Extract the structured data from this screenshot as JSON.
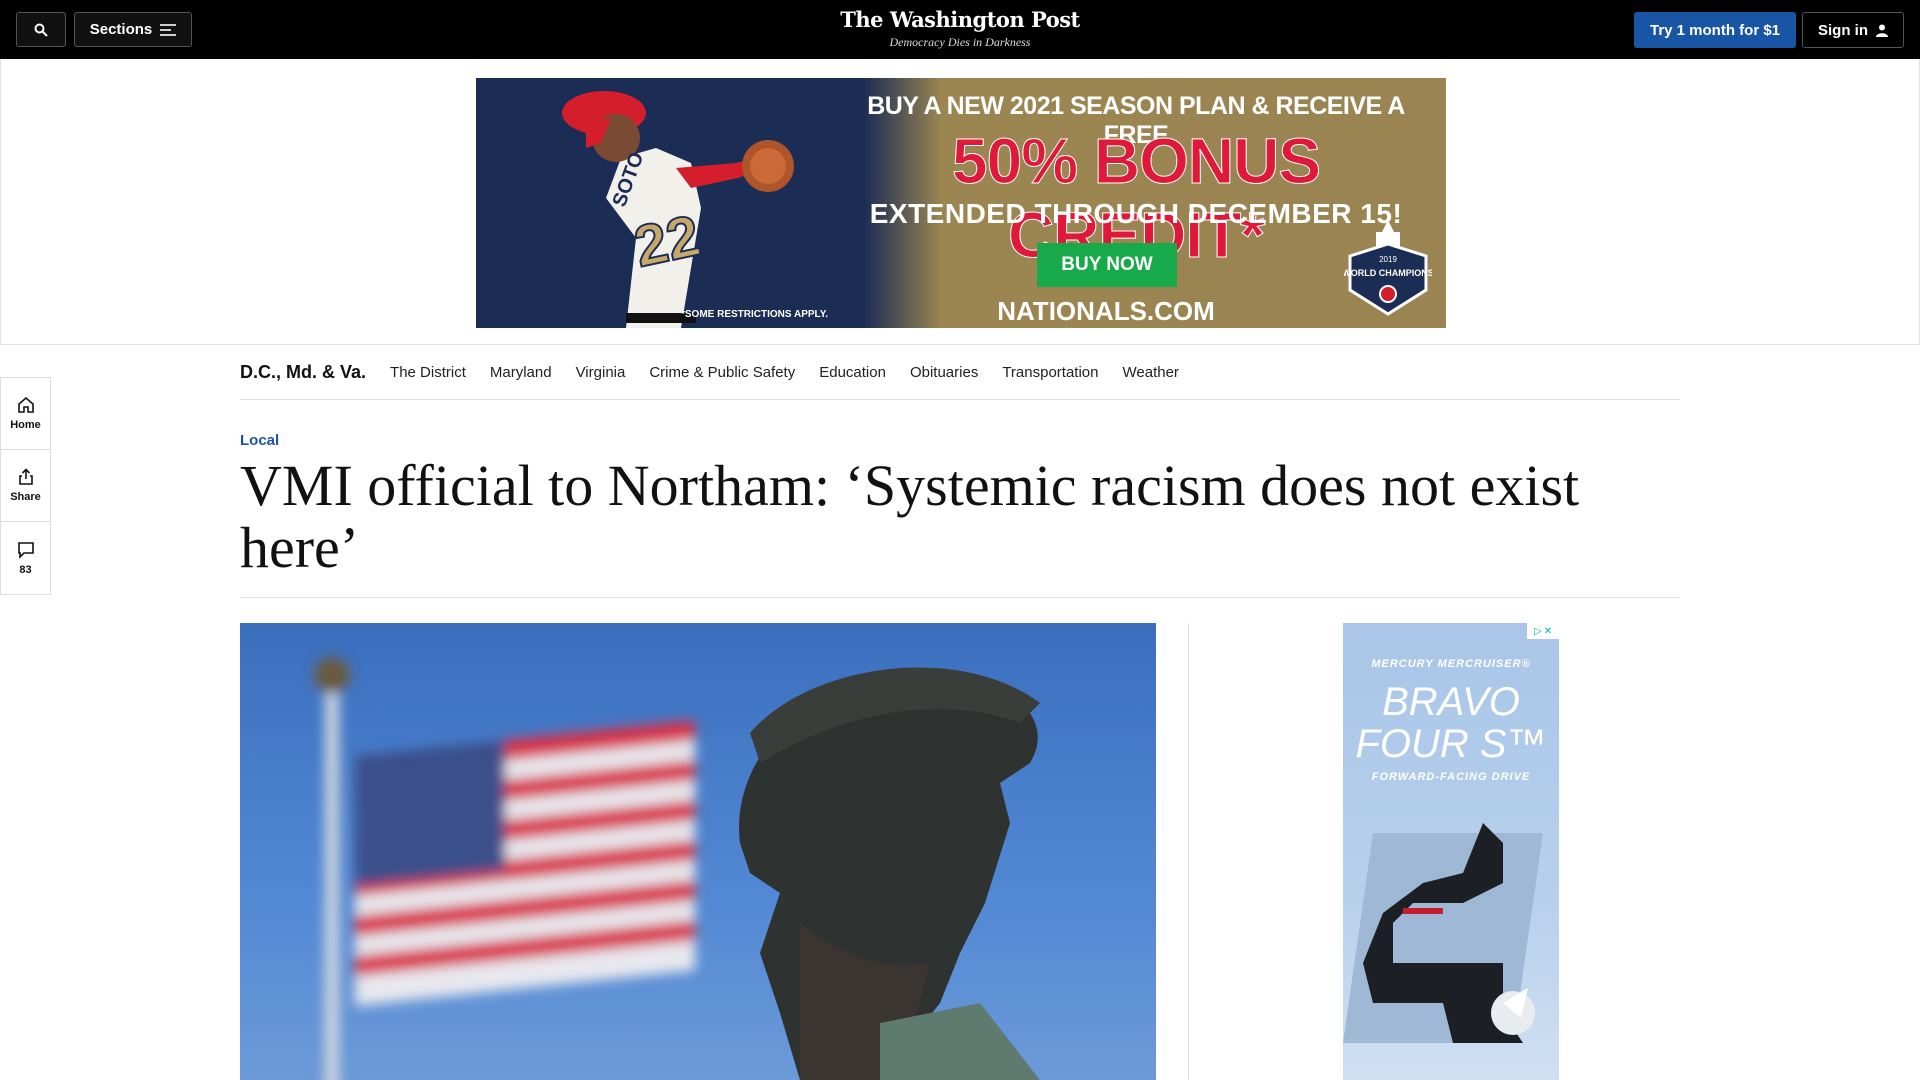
{
  "header": {
    "sections_label": "Sections",
    "logo": "The Washington Post",
    "tagline": "Democracy Dies in Darkness",
    "try_label": "Try 1 month for $1",
    "signin_label": "Sign in"
  },
  "banner_ad": {
    "line1": "BUY A NEW 2021 SEASON PLAN & RECEIVE A FREE",
    "line2": "50% BONUS CREDIT*",
    "line3": "EXTENDED THROUGH DECEMBER 15!",
    "button": "BUY NOW",
    "site": "NATIONALS.COM",
    "restrictions": "*SOME RESTRICTIONS APPLY.",
    "jersey_number": "22",
    "jersey_name": "SOTO",
    "badge_year": "2019",
    "badge_text": "WORLD CHAMPIONS"
  },
  "rail": {
    "home": "Home",
    "share": "Share",
    "comments": "83"
  },
  "subnav": {
    "title": "D.C., Md. & Va.",
    "links": [
      "The District",
      "Maryland",
      "Virginia",
      "Crime & Public Safety",
      "Education",
      "Obituaries",
      "Transportation",
      "Weather"
    ]
  },
  "article": {
    "kicker": "Local",
    "headline": "VMI official to Northam: ‘Systemic racism does not exist here’"
  },
  "side_ad": {
    "brand": "MERCURY MERCRUISER®",
    "title": "BRAVO FOUR S™",
    "subtitle": "FORWARD-FACING DRIVE"
  }
}
